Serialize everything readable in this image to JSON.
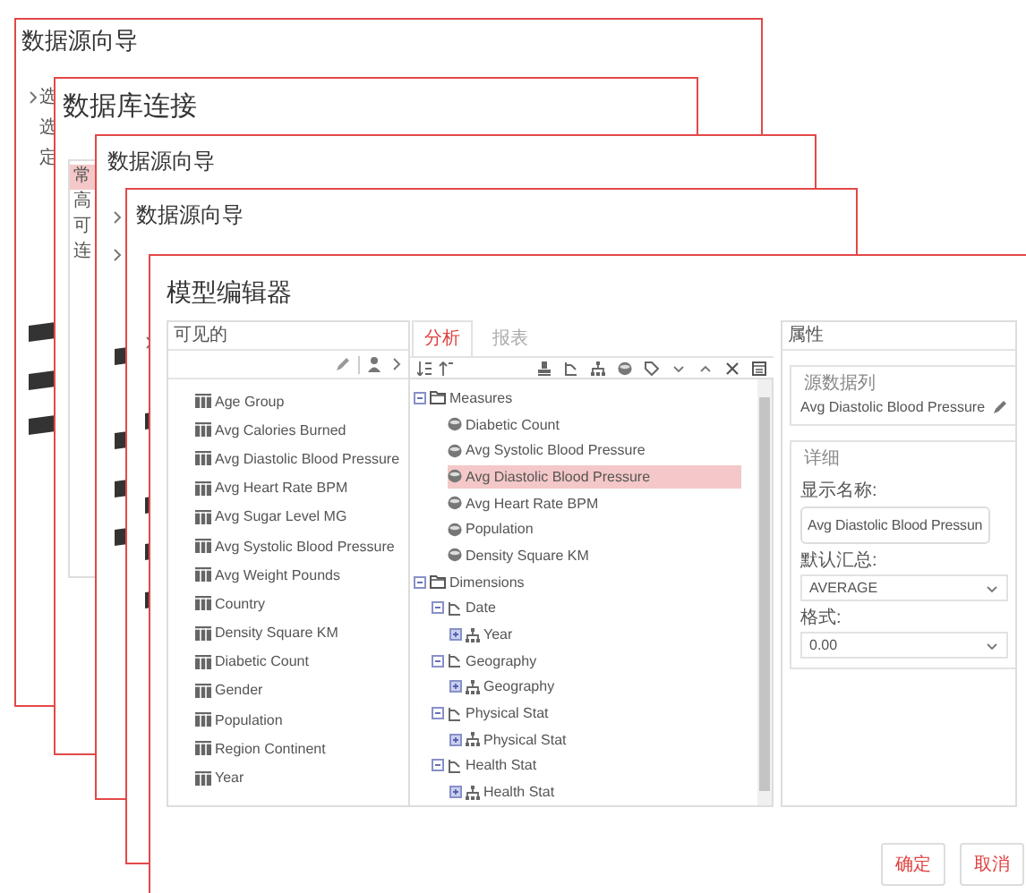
{
  "windows": [
    {
      "title": "数据源向导",
      "rows": [
        {
          "kind": "chevron-row",
          "text": "选"
        },
        {
          "kind": "row",
          "text": "选"
        },
        {
          "kind": "row",
          "text": "定"
        }
      ]
    },
    {
      "title": "数据库连接",
      "list": [
        {
          "text": "常",
          "selected": true
        },
        {
          "text": "高",
          "selected": false
        },
        {
          "text": "可",
          "selected": false
        },
        {
          "text": "连",
          "selected": false
        }
      ]
    },
    {
      "title": "数据源向导",
      "rows": [
        {
          "kind": "chevron"
        },
        {
          "kind": "chevron"
        }
      ]
    },
    {
      "title": "数据源向导",
      "rows": [
        {
          "kind": "chevron"
        }
      ]
    }
  ],
  "model_editor": {
    "title": "模型编辑器",
    "available": {
      "header": "可见的",
      "items": [
        "Age Group",
        "Avg Calories Burned",
        "Avg Diastolic Blood Pressure",
        "Avg Heart Rate BPM",
        "Avg Sugar Level MG",
        "Avg Systolic Blood Pressure",
        "Avg Weight Pounds",
        "Country",
        "Density Square KM",
        "Diabetic Count",
        "Gender",
        "Population",
        "Region Continent",
        "Year"
      ]
    },
    "tabs": [
      {
        "label": "分析",
        "selected": true
      },
      {
        "label": "报表",
        "selected": false
      }
    ],
    "tree": [
      {
        "kind": "folder",
        "label": "Measures",
        "expanded": true,
        "selected": false,
        "children": [
          {
            "kind": "measure",
            "label": "Diabetic Count",
            "selected": false
          },
          {
            "kind": "measure",
            "label": "Avg Systolic Blood Pressure",
            "selected": false
          },
          {
            "kind": "measure",
            "label": "Avg Diastolic Blood Pressure",
            "selected": true
          },
          {
            "kind": "measure",
            "label": "Avg Heart Rate BPM",
            "selected": false
          },
          {
            "kind": "measure",
            "label": "Population",
            "selected": false
          },
          {
            "kind": "measure",
            "label": "Density Square KM",
            "selected": false
          }
        ]
      },
      {
        "kind": "folder",
        "label": "Dimensions",
        "expanded": true,
        "selected": false,
        "children": [
          {
            "kind": "hierarchy",
            "label": "Date",
            "expanded": true,
            "selected": false,
            "children": [
              {
                "kind": "level",
                "label": "Year",
                "expanded": false,
                "selected": false
              }
            ]
          },
          {
            "kind": "hierarchy",
            "label": "Geography",
            "expanded": true,
            "selected": false,
            "children": [
              {
                "kind": "level",
                "label": "Geography",
                "expanded": false,
                "selected": false
              }
            ]
          },
          {
            "kind": "hierarchy",
            "label": "Physical Stat",
            "expanded": true,
            "selected": false,
            "children": [
              {
                "kind": "level",
                "label": "Physical Stat",
                "expanded": false,
                "selected": false
              }
            ]
          },
          {
            "kind": "hierarchy",
            "label": "Health Stat",
            "expanded": true,
            "selected": false,
            "children": [
              {
                "kind": "level",
                "label": "Health Stat",
                "expanded": false,
                "selected": false
              }
            ]
          }
        ]
      }
    ],
    "properties": {
      "header": "属性",
      "source_group": {
        "legend": "源数据列",
        "value": "Avg Diastolic Blood Pressure"
      },
      "detail_group": {
        "legend": "详细",
        "fields": [
          {
            "kind": "input",
            "label": "显示名称:",
            "value": "Avg Diastolic Blood Pressun"
          },
          {
            "kind": "select",
            "label": "默认汇总:",
            "value": "AVERAGE"
          },
          {
            "kind": "select",
            "label": "格式:",
            "value": "0.00"
          }
        ]
      }
    },
    "buttons": [
      "确定",
      "取消"
    ]
  }
}
